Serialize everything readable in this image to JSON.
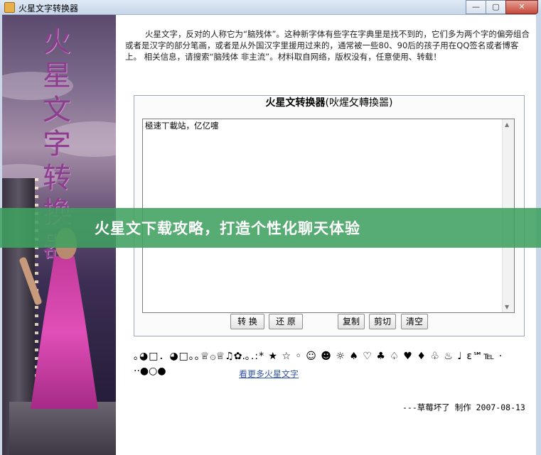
{
  "window": {
    "title": "火星文字转换器",
    "buttons": {
      "minimize": "—",
      "maximize": "▢",
      "close": "✕"
    }
  },
  "banner": {
    "title_chars": [
      "火",
      "星",
      "文",
      "字",
      "转",
      "换",
      "器"
    ]
  },
  "intro": "火星文字，反对的人称它为“脑残体”。这种新字体有些字在字典里是找不到的，它们多为两个字的偏旁组合或者是汉字的部分笔画，或者是从外国汉字里援用过来的，通常被一些80、90后的孩子用在QQ签名或者博客上。 相关信息，请搜索“脑残体 非主流”。材料取自网络，版权没有，任意使用、转载！",
  "converter": {
    "title_bold": "火星文转换器",
    "title_alt": "(吙煋攵轉換噐)",
    "text": "極速丅載站，亿亿嚏",
    "buttons": {
      "convert": "转 换",
      "restore": "还 原",
      "copy": "复制",
      "cut": "剪切",
      "clear": "清空"
    }
  },
  "symbols": {
    "row1": "｡◕□．◕□｡｡♕۞♕♫✿.｡.:* ★ ☆ ◦ ☺ ☻ ☼ ♠ ♡ ♣ ♤ ♥ ♦ ♧ ♨ ♩ ε℠℡ ·",
    "row2": "··●○●",
    "more_link": "看更多火星文字"
  },
  "signature": "---草莓坏了 制作 2007-08-13",
  "overlay": {
    "headline": "火星文下载攻略，打造个性化聊天体验"
  },
  "colors": {
    "overlay": "#40a060",
    "link": "#3355aa",
    "banner_text": "#8a3f8d"
  }
}
